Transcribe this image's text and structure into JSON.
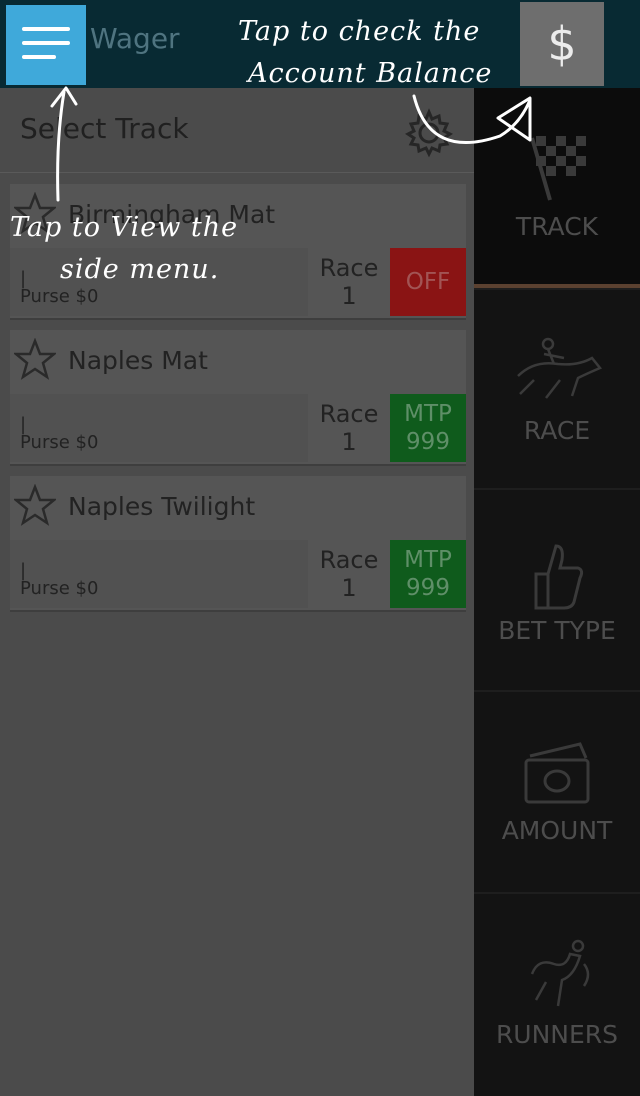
{
  "app": {
    "title": "Wager"
  },
  "header": {
    "balance_symbol": "$"
  },
  "main": {
    "title": "Select Track",
    "tracks": [
      {
        "name": "Birmingham Mat",
        "separator": "|",
        "purse": "Purse $0",
        "race_label": "Race",
        "race_number": "1",
        "status_line1": "OFF",
        "status_line2": "",
        "status_color": "#8a1414"
      },
      {
        "name": "Naples Mat",
        "separator": "|",
        "purse": "Purse $0",
        "race_label": "Race",
        "race_number": "1",
        "status_line1": "MTP",
        "status_line2": "999",
        "status_color": "#0f5b1c"
      },
      {
        "name": "Naples Twilight",
        "separator": "|",
        "purse": "Purse $0",
        "race_label": "Race",
        "race_number": "1",
        "status_line1": "MTP",
        "status_line2": "999",
        "status_color": "#0f5b1c"
      }
    ]
  },
  "nav": {
    "items": [
      {
        "label": "TRACK",
        "icon": "checkered-flag-icon"
      },
      {
        "label": "RACE",
        "icon": "horse-jockey-icon"
      },
      {
        "label": "BET TYPE",
        "icon": "thumbs-up-icon"
      },
      {
        "label": "AMOUNT",
        "icon": "money-icon"
      },
      {
        "label": "RUNNERS",
        "icon": "runners-icon"
      }
    ]
  },
  "annotations": {
    "balance_line1": "Tap to check the",
    "balance_line2": "Account Balance",
    "menu_line1": "Tap to View the",
    "menu_line2": "side menu."
  },
  "colors": {
    "menu_button": "#3fa9da",
    "topbar": "#082a33",
    "off": "#8a1414",
    "mtp": "#0f5b1c"
  }
}
